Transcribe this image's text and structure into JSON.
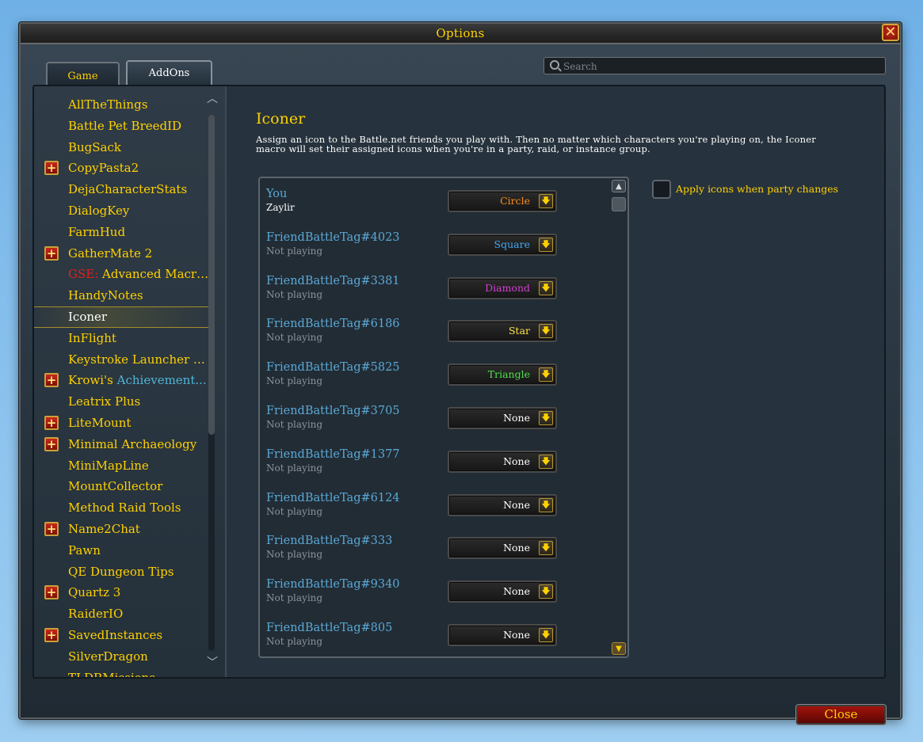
{
  "window": {
    "title": "Options",
    "close_icon": "close-x-icon"
  },
  "tabs": [
    {
      "label": "Game"
    },
    {
      "label": "AddOns"
    }
  ],
  "search": {
    "placeholder": "Search"
  },
  "addons": [
    {
      "name": "AllTheThings",
      "expandable": false
    },
    {
      "name": "Battle Pet BreedID",
      "expandable": false
    },
    {
      "name": "BugSack",
      "expandable": false
    },
    {
      "name": "CopyPasta2",
      "expandable": true
    },
    {
      "name": "DejaCharacterStats",
      "expandable": false
    },
    {
      "name": "DialogKey",
      "expandable": false
    },
    {
      "name": "FarmHud",
      "expandable": false
    },
    {
      "name": "GatherMate 2",
      "expandable": true
    },
    {
      "name_prefix": "GSE:",
      "name": "Advanced Macro...",
      "expandable": false
    },
    {
      "name": "HandyNotes",
      "expandable": false
    },
    {
      "name": "Iconer",
      "expandable": false,
      "selected": true
    },
    {
      "name": "InFlight",
      "expandable": false
    },
    {
      "name": "Keystroke Launcher R...",
      "expandable": false
    },
    {
      "name_prefix": "Krowi's",
      "name": "Achievement...",
      "expandable": true
    },
    {
      "name": "Leatrix Plus",
      "expandable": false
    },
    {
      "name": "LiteMount",
      "expandable": true
    },
    {
      "name": "Minimal Archaeology",
      "expandable": true
    },
    {
      "name": "MiniMapLine",
      "expandable": false
    },
    {
      "name": "MountCollector",
      "expandable": false
    },
    {
      "name": "Method Raid Tools",
      "expandable": false
    },
    {
      "name": "Name2Chat",
      "expandable": true
    },
    {
      "name": "Pawn",
      "expandable": false
    },
    {
      "name": "QE Dungeon Tips",
      "expandable": false
    },
    {
      "name": "Quartz 3",
      "expandable": true
    },
    {
      "name": "RaiderIO",
      "expandable": false
    },
    {
      "name": "SavedInstances",
      "expandable": true
    },
    {
      "name": "SilverDragon",
      "expandable": false
    },
    {
      "name": "TLDRMissions",
      "expandable": false
    }
  ],
  "iconer": {
    "title": "Iconer",
    "description": "Assign an icon to the Battle.net friends you play with. Then no matter which characters you're playing on, the Iconer macro will set their assigned icons when you're in a party, raid, or instance group.",
    "apply_label": "Apply icons when party changes",
    "apply_checked": false,
    "friends": [
      {
        "name": "You",
        "sub": "Zaylir",
        "icon": "Circle",
        "color": "#ff8c1a"
      },
      {
        "name": "FriendBattleTag#4023",
        "sub": "Not playing",
        "icon": "Square",
        "color": "#3fa9f5"
      },
      {
        "name": "FriendBattleTag#3381",
        "sub": "Not playing",
        "icon": "Diamond",
        "color": "#d43fd4"
      },
      {
        "name": "FriendBattleTag#6186",
        "sub": "Not playing",
        "icon": "Star",
        "color": "#ffe14a"
      },
      {
        "name": "FriendBattleTag#5825",
        "sub": "Not playing",
        "icon": "Triangle",
        "color": "#4ee04e"
      },
      {
        "name": "FriendBattleTag#3705",
        "sub": "Not playing",
        "icon": "None",
        "color": "#ffffff"
      },
      {
        "name": "FriendBattleTag#1377",
        "sub": "Not playing",
        "icon": "None",
        "color": "#ffffff"
      },
      {
        "name": "FriendBattleTag#6124",
        "sub": "Not playing",
        "icon": "None",
        "color": "#ffffff"
      },
      {
        "name": "FriendBattleTag#333",
        "sub": "Not playing",
        "icon": "None",
        "color": "#ffffff"
      },
      {
        "name": "FriendBattleTag#9340",
        "sub": "Not playing",
        "icon": "None",
        "color": "#ffffff"
      },
      {
        "name": "FriendBattleTag#805",
        "sub": "Not playing",
        "icon": "None",
        "color": "#ffffff"
      }
    ]
  },
  "buttons": {
    "close_label": "Close"
  },
  "colors": {
    "gold": "#ffd100",
    "friend_name": "#5aa9d6",
    "gse_red": "#e0211b",
    "krowi_blue": "#4fb6d9"
  }
}
